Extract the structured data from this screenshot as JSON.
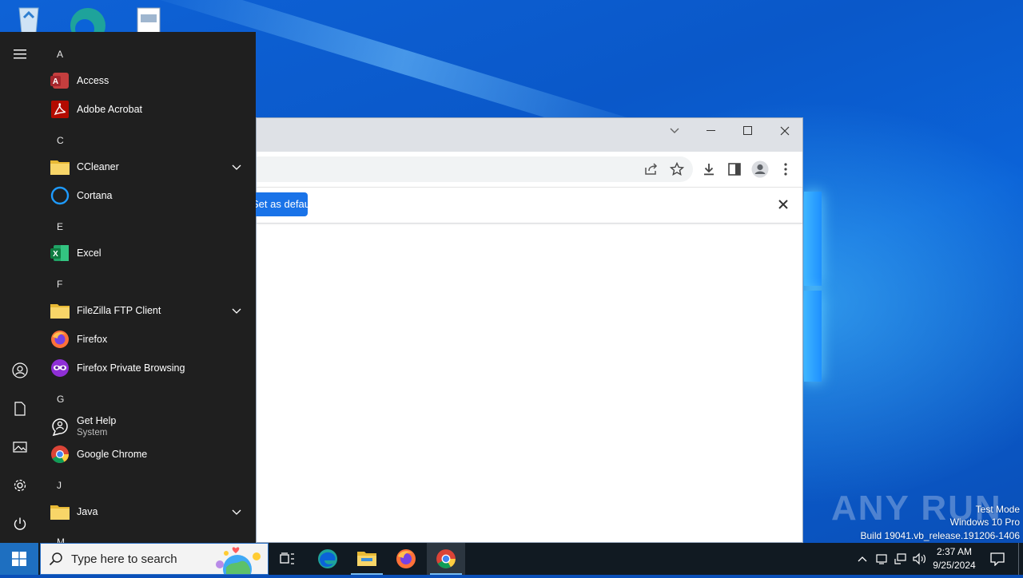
{
  "desktop": {
    "icons": [
      "recycle-bin-icon",
      "edge-icon",
      "file-icon"
    ]
  },
  "browser": {
    "infobar_button_label": "Set as default"
  },
  "start_menu": {
    "sections": [
      {
        "letter": "A",
        "apps": [
          {
            "label": "Access",
            "icon": "access-icon"
          },
          {
            "label": "Adobe Acrobat",
            "icon": "acrobat-icon"
          }
        ]
      },
      {
        "letter": "C",
        "apps": [
          {
            "label": "CCleaner",
            "icon": "folder-icon",
            "expandable": true
          },
          {
            "label": "Cortana",
            "icon": "cortana-icon"
          }
        ]
      },
      {
        "letter": "E",
        "apps": [
          {
            "label": "Excel",
            "icon": "excel-icon"
          }
        ]
      },
      {
        "letter": "F",
        "apps": [
          {
            "label": "FileZilla FTP Client",
            "icon": "folder-icon",
            "expandable": true
          },
          {
            "label": "Firefox",
            "icon": "firefox-icon"
          },
          {
            "label": "Firefox Private Browsing",
            "icon": "firefox-private-icon"
          }
        ]
      },
      {
        "letter": "G",
        "apps": [
          {
            "label": "Get Help",
            "sublabel": "System",
            "icon": "get-help-icon"
          },
          {
            "label": "Google Chrome",
            "icon": "chrome-icon"
          }
        ]
      },
      {
        "letter": "J",
        "apps": [
          {
            "label": "Java",
            "icon": "folder-icon",
            "expandable": true
          }
        ]
      },
      {
        "letter": "M",
        "apps": []
      }
    ]
  },
  "watermark": {
    "brand": "ANY RUN",
    "line1": "Test Mode",
    "line2": "Windows 10 Pro",
    "line3": "Build 19041.vb_release.191206-1406"
  },
  "taskbar": {
    "search_placeholder": "Type here to search",
    "time": "2:37 AM",
    "date": "9/25/2024"
  },
  "colors": {
    "accent": "#1a73e8",
    "start_bg": "#1f1f1f",
    "taskbar_bg": "#111a22"
  }
}
